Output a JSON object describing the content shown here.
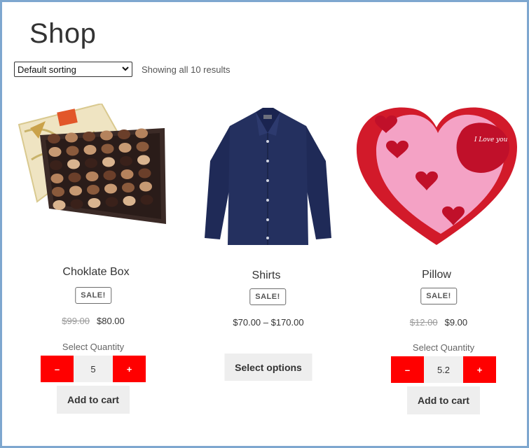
{
  "page": {
    "title": "Shop"
  },
  "toolbar": {
    "sort_value": "Default sorting",
    "result_count": "Showing all 10 results"
  },
  "products": [
    {
      "title": "Choklate Box",
      "badge": "SALE!",
      "old_price": "$99.00",
      "price": "$80.00",
      "qty_label": "Select Quantity",
      "qty_minus": "–",
      "qty_value": "5",
      "qty_plus": "+",
      "button": "Add to cart",
      "image": "chocolate-box-image"
    },
    {
      "title": "Shirts",
      "badge": "SALE!",
      "price_range": "$70.00 – $170.00",
      "button": "Select options",
      "image": "navy-shirt-image"
    },
    {
      "title": "Pillow",
      "badge": "SALE!",
      "old_price": "$12.00",
      "price": "$9.00",
      "qty_label": "Select Quantity",
      "qty_minus": "–",
      "qty_value": "5.2",
      "qty_plus": "+",
      "button": "Add to cart",
      "image": "heart-pillow-image",
      "pillow_text": "I Love you"
    }
  ],
  "colors": {
    "border": "#7ea7cf",
    "qty_button": "#ff0000",
    "button_bg": "#eeeeee"
  }
}
